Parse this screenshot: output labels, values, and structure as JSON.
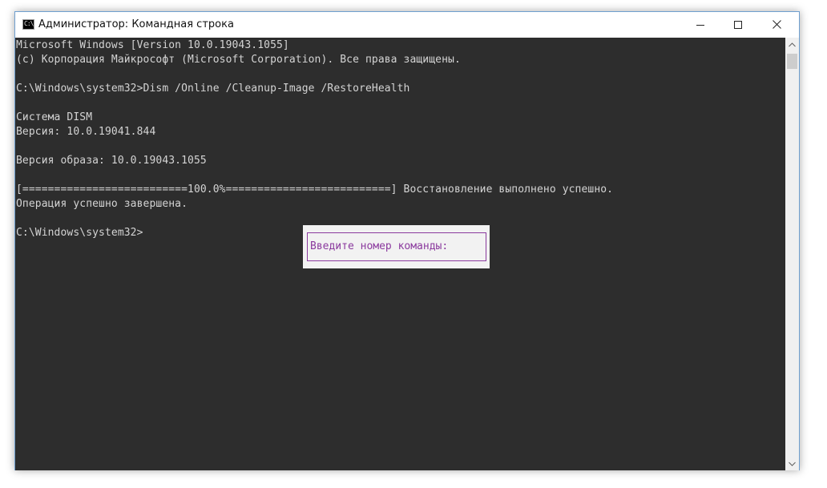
{
  "window": {
    "title": "Администратор: Командная строка",
    "icon": "cmd-icon",
    "icon_glyph": "C:\\",
    "controls": [
      "minimize-icon",
      "maximize-icon",
      "close-icon"
    ]
  },
  "console": {
    "lines": [
      "Microsoft Windows [Version 10.0.19043.1055]",
      "(c) Корпорация Майкрософт (Microsoft Corporation). Все права защищены.",
      "",
      "C:\\Windows\\system32>Dism /Online /Cleanup-Image /RestoreHealth",
      "",
      "Система DISM",
      "Версия: 10.0.19041.844",
      "",
      "Версия образа: 10.0.19043.1055",
      "",
      "[==========================100.0%==========================] Восстановление выполнено успешно.",
      "Операция успешно завершена.",
      "",
      "C:\\Windows\\system32>"
    ],
    "text_color": "#d4d4d4",
    "background_color": "#2d2d2d"
  },
  "popup": {
    "prompt": "Введите номер команды:",
    "accent_color": "#8b3a9e"
  }
}
